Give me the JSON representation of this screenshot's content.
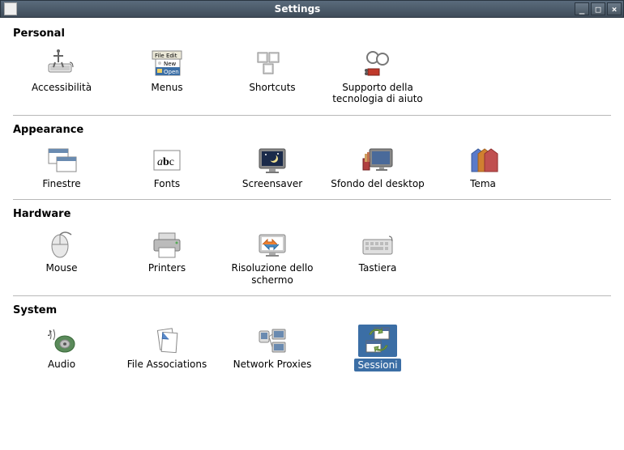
{
  "window": {
    "title": "Settings"
  },
  "sections": [
    {
      "title": "Personal",
      "items": [
        {
          "label": "Accessibilità",
          "icon": "accessibility-icon",
          "selected": false
        },
        {
          "label": "Menus",
          "icon": "menus-icon",
          "selected": false
        },
        {
          "label": "Shortcuts",
          "icon": "shortcuts-icon",
          "selected": false
        },
        {
          "label": "Supporto della tecnologia di aiuto",
          "icon": "assistive-tech-icon",
          "selected": false
        }
      ]
    },
    {
      "title": "Appearance",
      "items": [
        {
          "label": "Finestre",
          "icon": "windows-icon",
          "selected": false
        },
        {
          "label": "Fonts",
          "icon": "fonts-icon",
          "selected": false
        },
        {
          "label": "Screensaver",
          "icon": "screensaver-icon",
          "selected": false
        },
        {
          "label": "Sfondo del desktop",
          "icon": "wallpaper-icon",
          "selected": false
        },
        {
          "label": "Tema",
          "icon": "theme-icon",
          "selected": false
        }
      ]
    },
    {
      "title": "Hardware",
      "items": [
        {
          "label": "Mouse",
          "icon": "mouse-icon",
          "selected": false
        },
        {
          "label": "Printers",
          "icon": "printer-icon",
          "selected": false
        },
        {
          "label": "Risoluzione dello schermo",
          "icon": "display-icon",
          "selected": false
        },
        {
          "label": "Tastiera",
          "icon": "keyboard-icon",
          "selected": false
        }
      ]
    },
    {
      "title": "System",
      "items": [
        {
          "label": "Audio",
          "icon": "audio-icon",
          "selected": false
        },
        {
          "label": "File Associations",
          "icon": "file-assoc-icon",
          "selected": false
        },
        {
          "label": "Network Proxies",
          "icon": "network-icon",
          "selected": false
        },
        {
          "label": "Sessioni",
          "icon": "sessions-icon",
          "selected": true
        }
      ]
    }
  ]
}
